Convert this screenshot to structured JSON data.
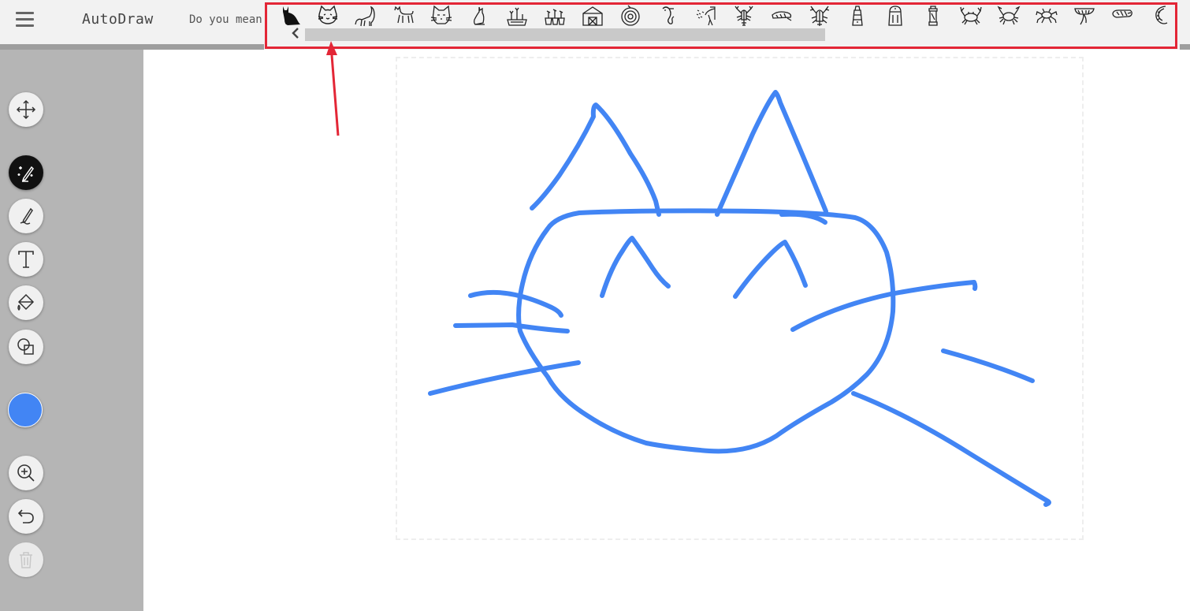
{
  "app": {
    "title": "AutoDraw"
  },
  "topbar": {
    "menu_icon": "hamburger-menu-icon",
    "suggest_prompt": "Do you mean:"
  },
  "suggestions": [
    "black-cat-icon",
    "cat-face-icon",
    "cat-stretching-icon",
    "cat-walking-icon",
    "cat-head-icon",
    "cat-sitting-icon",
    "planter-icon",
    "plant-pots-icon",
    "barn-icon",
    "spiral-icon",
    "seahorse-icon",
    "shower-icon",
    "lobster-icon",
    "shrimp-icon",
    "crayfish-icon",
    "lighthouse-icon",
    "salt-shaker-icon",
    "lantern-icon",
    "crab-icon",
    "crab-outline-icon",
    "spider-crab-icon",
    "shrimp-plate-icon",
    "fish-fillet-icon",
    "shrimp-curl-icon"
  ],
  "tools": [
    {
      "name": "move-tool",
      "icon": "move-arrows-icon"
    },
    {
      "name": "autodraw-tool",
      "icon": "magic-pencil-icon",
      "active": true
    },
    {
      "name": "draw-tool",
      "icon": "pencil-icon"
    },
    {
      "name": "type-tool",
      "icon": "text-icon"
    },
    {
      "name": "fill-tool",
      "icon": "paint-bucket-icon"
    },
    {
      "name": "shape-tool",
      "icon": "shapes-icon"
    },
    {
      "name": "zoom-tool",
      "icon": "zoom-in-icon"
    },
    {
      "name": "undo-tool",
      "icon": "undo-icon"
    },
    {
      "name": "delete-tool",
      "icon": "trash-icon",
      "disabled": true
    }
  ],
  "colors": {
    "stroke": "#4285f4",
    "highlight": "#e32636",
    "active_tool": "#111111"
  }
}
